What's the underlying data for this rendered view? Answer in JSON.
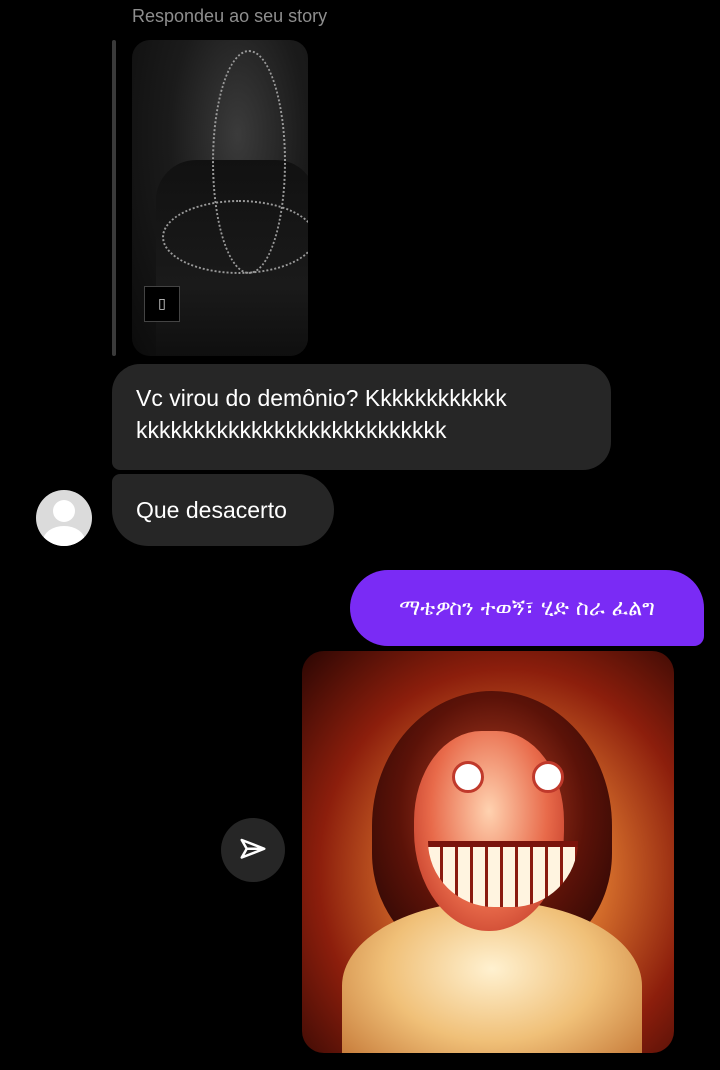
{
  "story_reply": {
    "label": "Respondeu ao seu story"
  },
  "messages": {
    "received_1": "Vc virou do demônio? Kkkkkkkkkkkk kkkkkkkkkkkkkkkkkkkkkkkkkkk",
    "received_2": "Que desacerto",
    "sent_text": "ማቴዎስን ተወኝ፣ ሂድ ስራ ፈልግ"
  },
  "icons": {
    "avatar": "default-avatar-icon",
    "share": "paper-plane-icon"
  },
  "colors": {
    "background": "#000000",
    "received_bubble": "#262626",
    "sent_bubble": "#7a2bf5",
    "meta_text": "#8e8e8e"
  }
}
